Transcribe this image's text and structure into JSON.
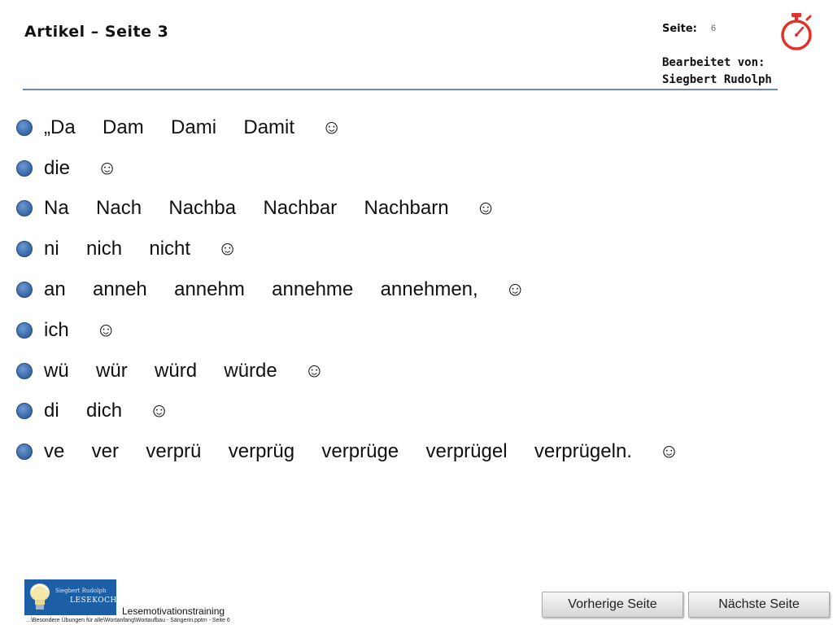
{
  "header": {
    "title": "Artikel – Seite 3",
    "page_label": "Seite:",
    "page_number": "6",
    "edited_by": "Bearbeitet von:\nSiegbert Rudolph"
  },
  "lines": [
    "„Da  Dam  Dami  Damit  ☺",
    "die  ☺",
    "Na  Nach  Nachba  Nachbar  Nachbarn  ☺",
    "ni  nich  nicht  ☺",
    "an  anneh  annehm  annehme  annehmen,  ☺",
    "ich  ☺",
    "wü  wür  würd  würde  ☺",
    "di  dich  ☺",
    "ve  ver  verprü  verprüg  verprüge  verprügel  verprügeln.  ☺"
  ],
  "logo": {
    "top_text": "Siegbert Rudolph",
    "bottom_text": "LESEKOCH"
  },
  "footer": {
    "title": "Lesemotivationstraining",
    "path": "...\\Besondere Übungen für alle\\Wortanfang\\Wortaufbau - Sängerin.pptm - Seite 6"
  },
  "nav": {
    "prev_label": "Vorherige Seite",
    "next_label": "Nächste Seite"
  },
  "colors": {
    "accent_blue": "#3f6fae",
    "stopwatch_red": "#e0322a",
    "rule": "#6a8bb8"
  },
  "icons": {
    "stopwatch": "stopwatch-icon",
    "bullet": "circle-bullet-icon"
  }
}
